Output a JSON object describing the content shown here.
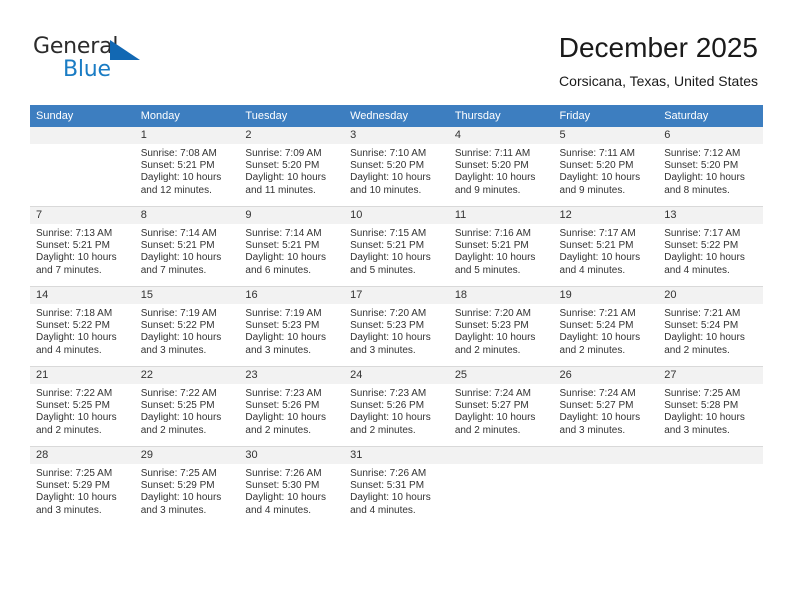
{
  "brand": {
    "name_part1": "General",
    "name_part2": "Blue",
    "accent_color": "#1a7cc4",
    "triangle_color": "#1268b3"
  },
  "header": {
    "month_title": "December 2025",
    "location": "Corsicana, Texas, United States"
  },
  "calendar": {
    "header_bg": "#3d7ec0",
    "daynum_bg": "#f2f2f2",
    "weekday_names": [
      "Sunday",
      "Monday",
      "Tuesday",
      "Wednesday",
      "Thursday",
      "Friday",
      "Saturday"
    ],
    "weeks": [
      [
        {
          "day": "",
          "empty": true,
          "sunrise": "",
          "sunset": "",
          "daylight_line1": "",
          "daylight_line2": ""
        },
        {
          "day": "1",
          "empty": false,
          "sunrise": "Sunrise: 7:08 AM",
          "sunset": "Sunset: 5:21 PM",
          "daylight_line1": "Daylight: 10 hours",
          "daylight_line2": "and 12 minutes."
        },
        {
          "day": "2",
          "empty": false,
          "sunrise": "Sunrise: 7:09 AM",
          "sunset": "Sunset: 5:20 PM",
          "daylight_line1": "Daylight: 10 hours",
          "daylight_line2": "and 11 minutes."
        },
        {
          "day": "3",
          "empty": false,
          "sunrise": "Sunrise: 7:10 AM",
          "sunset": "Sunset: 5:20 PM",
          "daylight_line1": "Daylight: 10 hours",
          "daylight_line2": "and 10 minutes."
        },
        {
          "day": "4",
          "empty": false,
          "sunrise": "Sunrise: 7:11 AM",
          "sunset": "Sunset: 5:20 PM",
          "daylight_line1": "Daylight: 10 hours",
          "daylight_line2": "and 9 minutes."
        },
        {
          "day": "5",
          "empty": false,
          "sunrise": "Sunrise: 7:11 AM",
          "sunset": "Sunset: 5:20 PM",
          "daylight_line1": "Daylight: 10 hours",
          "daylight_line2": "and 9 minutes."
        },
        {
          "day": "6",
          "empty": false,
          "sunrise": "Sunrise: 7:12 AM",
          "sunset": "Sunset: 5:20 PM",
          "daylight_line1": "Daylight: 10 hours",
          "daylight_line2": "and 8 minutes."
        }
      ],
      [
        {
          "day": "7",
          "empty": false,
          "sunrise": "Sunrise: 7:13 AM",
          "sunset": "Sunset: 5:21 PM",
          "daylight_line1": "Daylight: 10 hours",
          "daylight_line2": "and 7 minutes."
        },
        {
          "day": "8",
          "empty": false,
          "sunrise": "Sunrise: 7:14 AM",
          "sunset": "Sunset: 5:21 PM",
          "daylight_line1": "Daylight: 10 hours",
          "daylight_line2": "and 7 minutes."
        },
        {
          "day": "9",
          "empty": false,
          "sunrise": "Sunrise: 7:14 AM",
          "sunset": "Sunset: 5:21 PM",
          "daylight_line1": "Daylight: 10 hours",
          "daylight_line2": "and 6 minutes."
        },
        {
          "day": "10",
          "empty": false,
          "sunrise": "Sunrise: 7:15 AM",
          "sunset": "Sunset: 5:21 PM",
          "daylight_line1": "Daylight: 10 hours",
          "daylight_line2": "and 5 minutes."
        },
        {
          "day": "11",
          "empty": false,
          "sunrise": "Sunrise: 7:16 AM",
          "sunset": "Sunset: 5:21 PM",
          "daylight_line1": "Daylight: 10 hours",
          "daylight_line2": "and 5 minutes."
        },
        {
          "day": "12",
          "empty": false,
          "sunrise": "Sunrise: 7:17 AM",
          "sunset": "Sunset: 5:21 PM",
          "daylight_line1": "Daylight: 10 hours",
          "daylight_line2": "and 4 minutes."
        },
        {
          "day": "13",
          "empty": false,
          "sunrise": "Sunrise: 7:17 AM",
          "sunset": "Sunset: 5:22 PM",
          "daylight_line1": "Daylight: 10 hours",
          "daylight_line2": "and 4 minutes."
        }
      ],
      [
        {
          "day": "14",
          "empty": false,
          "sunrise": "Sunrise: 7:18 AM",
          "sunset": "Sunset: 5:22 PM",
          "daylight_line1": "Daylight: 10 hours",
          "daylight_line2": "and 4 minutes."
        },
        {
          "day": "15",
          "empty": false,
          "sunrise": "Sunrise: 7:19 AM",
          "sunset": "Sunset: 5:22 PM",
          "daylight_line1": "Daylight: 10 hours",
          "daylight_line2": "and 3 minutes."
        },
        {
          "day": "16",
          "empty": false,
          "sunrise": "Sunrise: 7:19 AM",
          "sunset": "Sunset: 5:23 PM",
          "daylight_line1": "Daylight: 10 hours",
          "daylight_line2": "and 3 minutes."
        },
        {
          "day": "17",
          "empty": false,
          "sunrise": "Sunrise: 7:20 AM",
          "sunset": "Sunset: 5:23 PM",
          "daylight_line1": "Daylight: 10 hours",
          "daylight_line2": "and 3 minutes."
        },
        {
          "day": "18",
          "empty": false,
          "sunrise": "Sunrise: 7:20 AM",
          "sunset": "Sunset: 5:23 PM",
          "daylight_line1": "Daylight: 10 hours",
          "daylight_line2": "and 2 minutes."
        },
        {
          "day": "19",
          "empty": false,
          "sunrise": "Sunrise: 7:21 AM",
          "sunset": "Sunset: 5:24 PM",
          "daylight_line1": "Daylight: 10 hours",
          "daylight_line2": "and 2 minutes."
        },
        {
          "day": "20",
          "empty": false,
          "sunrise": "Sunrise: 7:21 AM",
          "sunset": "Sunset: 5:24 PM",
          "daylight_line1": "Daylight: 10 hours",
          "daylight_line2": "and 2 minutes."
        }
      ],
      [
        {
          "day": "21",
          "empty": false,
          "sunrise": "Sunrise: 7:22 AM",
          "sunset": "Sunset: 5:25 PM",
          "daylight_line1": "Daylight: 10 hours",
          "daylight_line2": "and 2 minutes."
        },
        {
          "day": "22",
          "empty": false,
          "sunrise": "Sunrise: 7:22 AM",
          "sunset": "Sunset: 5:25 PM",
          "daylight_line1": "Daylight: 10 hours",
          "daylight_line2": "and 2 minutes."
        },
        {
          "day": "23",
          "empty": false,
          "sunrise": "Sunrise: 7:23 AM",
          "sunset": "Sunset: 5:26 PM",
          "daylight_line1": "Daylight: 10 hours",
          "daylight_line2": "and 2 minutes."
        },
        {
          "day": "24",
          "empty": false,
          "sunrise": "Sunrise: 7:23 AM",
          "sunset": "Sunset: 5:26 PM",
          "daylight_line1": "Daylight: 10 hours",
          "daylight_line2": "and 2 minutes."
        },
        {
          "day": "25",
          "empty": false,
          "sunrise": "Sunrise: 7:24 AM",
          "sunset": "Sunset: 5:27 PM",
          "daylight_line1": "Daylight: 10 hours",
          "daylight_line2": "and 2 minutes."
        },
        {
          "day": "26",
          "empty": false,
          "sunrise": "Sunrise: 7:24 AM",
          "sunset": "Sunset: 5:27 PM",
          "daylight_line1": "Daylight: 10 hours",
          "daylight_line2": "and 3 minutes."
        },
        {
          "day": "27",
          "empty": false,
          "sunrise": "Sunrise: 7:25 AM",
          "sunset": "Sunset: 5:28 PM",
          "daylight_line1": "Daylight: 10 hours",
          "daylight_line2": "and 3 minutes."
        }
      ],
      [
        {
          "day": "28",
          "empty": false,
          "sunrise": "Sunrise: 7:25 AM",
          "sunset": "Sunset: 5:29 PM",
          "daylight_line1": "Daylight: 10 hours",
          "daylight_line2": "and 3 minutes."
        },
        {
          "day": "29",
          "empty": false,
          "sunrise": "Sunrise: 7:25 AM",
          "sunset": "Sunset: 5:29 PM",
          "daylight_line1": "Daylight: 10 hours",
          "daylight_line2": "and 3 minutes."
        },
        {
          "day": "30",
          "empty": false,
          "sunrise": "Sunrise: 7:26 AM",
          "sunset": "Sunset: 5:30 PM",
          "daylight_line1": "Daylight: 10 hours",
          "daylight_line2": "and 4 minutes."
        },
        {
          "day": "31",
          "empty": false,
          "sunrise": "Sunrise: 7:26 AM",
          "sunset": "Sunset: 5:31 PM",
          "daylight_line1": "Daylight: 10 hours",
          "daylight_line2": "and 4 minutes."
        },
        {
          "day": "",
          "empty": true,
          "sunrise": "",
          "sunset": "",
          "daylight_line1": "",
          "daylight_line2": ""
        },
        {
          "day": "",
          "empty": true,
          "sunrise": "",
          "sunset": "",
          "daylight_line1": "",
          "daylight_line2": ""
        },
        {
          "day": "",
          "empty": true,
          "sunrise": "",
          "sunset": "",
          "daylight_line1": "",
          "daylight_line2": ""
        }
      ]
    ]
  }
}
